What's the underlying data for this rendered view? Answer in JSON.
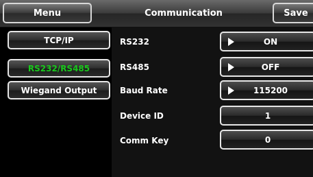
{
  "header": {
    "menu_label": "Menu",
    "title": "Communication",
    "save_label": "Save"
  },
  "sidebar": {
    "items": [
      {
        "label": "TCP/IP",
        "active": false
      },
      {
        "label": "RS232/RS485",
        "active": true
      },
      {
        "label": "Wiegand Output",
        "active": false
      }
    ]
  },
  "settings": [
    {
      "label": "RS232",
      "value": "ON"
    },
    {
      "label": "RS485",
      "value": "OFF"
    },
    {
      "label": "Baud Rate",
      "value": "115200"
    },
    {
      "label": "Device ID",
      "value": "1"
    },
    {
      "label": "Comm Key",
      "value": "0"
    }
  ],
  "colors": {
    "active_tab_text": "#19c61c",
    "background": "#000000",
    "panel": "#121212"
  },
  "icons": {
    "dropdown_arrow": "play-arrow-icon"
  }
}
